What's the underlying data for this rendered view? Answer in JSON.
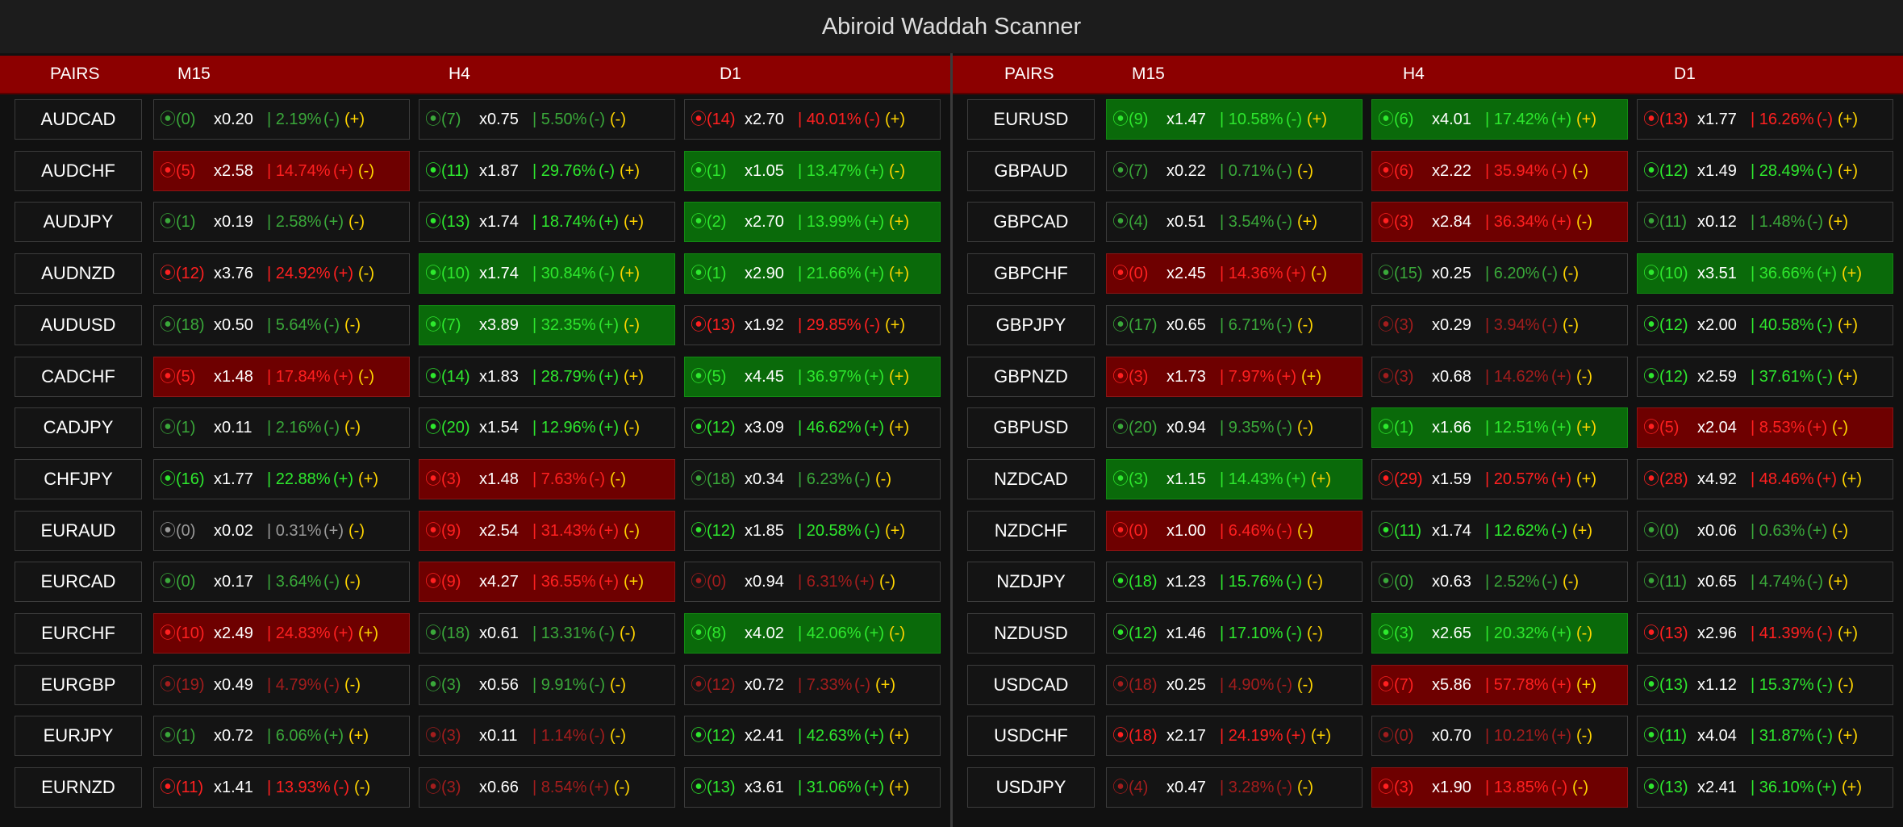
{
  "title": "Abiroid Waddah Scanner",
  "headers": {
    "pairs": "PAIRS",
    "m15": "M15",
    "h4": "H4",
    "d1": "D1"
  },
  "colors": {
    "header_bg": "#8c0000",
    "green": "#2ee82e",
    "red": "#ff2020",
    "yellow": "#ffd400",
    "highlight_green": "#0a6a0a",
    "highlight_red": "#6e0000"
  },
  "icons": {
    "status": "target-icon"
  },
  "left": [
    {
      "pair": "AUDCAD",
      "cells": [
        {
          "status": "⦿(0)",
          "ratio": "x0.20",
          "pct": "| 2.19%",
          "sign": "(-)",
          "arrow": "(+)",
          "color": "dgreen",
          "hl": ""
        },
        {
          "status": "⦿(7)",
          "ratio": "x0.75",
          "pct": "| 5.50%",
          "sign": "(-)",
          "arrow": "(-)",
          "color": "dgreen",
          "hl": ""
        },
        {
          "status": "⦿(14)",
          "ratio": "x2.70",
          "pct": "| 40.01%",
          "sign": "(-)",
          "arrow": "(+)",
          "color": "red",
          "hl": ""
        }
      ]
    },
    {
      "pair": "AUDCHF",
      "cells": [
        {
          "status": "⦿(5)",
          "ratio": "x2.58",
          "pct": "| 14.74%",
          "sign": "(+)",
          "arrow": "(-)",
          "color": "red",
          "hl": "red"
        },
        {
          "status": "⦿(11)",
          "ratio": "x1.87",
          "pct": "| 29.76%",
          "sign": "(-)",
          "arrow": "(+)",
          "color": "green",
          "hl": ""
        },
        {
          "status": "⦿(1)",
          "ratio": "x1.05",
          "pct": "| 13.47%",
          "sign": "(+)",
          "arrow": "(-)",
          "color": "green",
          "hl": "green"
        }
      ]
    },
    {
      "pair": "AUDJPY",
      "cells": [
        {
          "status": "⦿(1)",
          "ratio": "x0.19",
          "pct": "| 2.58%",
          "sign": "(+)",
          "arrow": "(-)",
          "color": "dgreen",
          "hl": ""
        },
        {
          "status": "⦿(13)",
          "ratio": "x1.74",
          "pct": "| 18.74%",
          "sign": "(+)",
          "arrow": "(+)",
          "color": "green",
          "hl": ""
        },
        {
          "status": "⦿(2)",
          "ratio": "x2.70",
          "pct": "| 13.99%",
          "sign": "(+)",
          "arrow": "(+)",
          "color": "green",
          "hl": "green"
        }
      ]
    },
    {
      "pair": "AUDNZD",
      "cells": [
        {
          "status": "⦿(12)",
          "ratio": "x3.76",
          "pct": "| 24.92%",
          "sign": "(+)",
          "arrow": "(-)",
          "color": "red",
          "hl": ""
        },
        {
          "status": "⦿(10)",
          "ratio": "x1.74",
          "pct": "| 30.84%",
          "sign": "(-)",
          "arrow": "(+)",
          "color": "green",
          "hl": "green"
        },
        {
          "status": "⦿(1)",
          "ratio": "x2.90",
          "pct": "| 21.66%",
          "sign": "(+)",
          "arrow": "(+)",
          "color": "green",
          "hl": "green"
        }
      ]
    },
    {
      "pair": "AUDUSD",
      "cells": [
        {
          "status": "⦿(18)",
          "ratio": "x0.50",
          "pct": "| 5.64%",
          "sign": "(-)",
          "arrow": "(-)",
          "color": "dgreen",
          "hl": ""
        },
        {
          "status": "⦿(7)",
          "ratio": "x3.89",
          "pct": "| 32.35%",
          "sign": "(+)",
          "arrow": "(-)",
          "color": "green",
          "hl": "green"
        },
        {
          "status": "⦿(13)",
          "ratio": "x1.92",
          "pct": "| 29.85%",
          "sign": "(-)",
          "arrow": "(+)",
          "color": "red",
          "hl": ""
        }
      ]
    },
    {
      "pair": "CADCHF",
      "cells": [
        {
          "status": "⦿(5)",
          "ratio": "x1.48",
          "pct": "| 17.84%",
          "sign": "(+)",
          "arrow": "(-)",
          "color": "red",
          "hl": "red"
        },
        {
          "status": "⦿(14)",
          "ratio": "x1.83",
          "pct": "| 28.79%",
          "sign": "(+)",
          "arrow": "(+)",
          "color": "green",
          "hl": ""
        },
        {
          "status": "⦿(5)",
          "ratio": "x4.45",
          "pct": "| 36.97%",
          "sign": "(+)",
          "arrow": "(+)",
          "color": "green",
          "hl": "green"
        }
      ]
    },
    {
      "pair": "CADJPY",
      "cells": [
        {
          "status": "⦿(1)",
          "ratio": "x0.11",
          "pct": "| 2.16%",
          "sign": "(-)",
          "arrow": "(-)",
          "color": "dgreen",
          "hl": ""
        },
        {
          "status": "⦿(20)",
          "ratio": "x1.54",
          "pct": "| 12.96%",
          "sign": "(+)",
          "arrow": "(-)",
          "color": "green",
          "hl": ""
        },
        {
          "status": "⦿(12)",
          "ratio": "x3.09",
          "pct": "| 46.62%",
          "sign": "(+)",
          "arrow": "(+)",
          "color": "green",
          "hl": ""
        }
      ]
    },
    {
      "pair": "CHFJPY",
      "cells": [
        {
          "status": "⦿(16)",
          "ratio": "x1.77",
          "pct": "| 22.88%",
          "sign": "(+)",
          "arrow": "(+)",
          "color": "green",
          "hl": ""
        },
        {
          "status": "⦿(3)",
          "ratio": "x1.48",
          "pct": "| 7.63%",
          "sign": "(-)",
          "arrow": "(-)",
          "color": "red",
          "hl": "red"
        },
        {
          "status": "⦿(18)",
          "ratio": "x0.34",
          "pct": "| 6.23%",
          "sign": "(-)",
          "arrow": "(-)",
          "color": "dgreen",
          "hl": ""
        }
      ]
    },
    {
      "pair": "EURAUD",
      "cells": [
        {
          "status": "⦿(0)",
          "ratio": "x0.02",
          "pct": "| 0.31%",
          "sign": "(+)",
          "arrow": "(-)",
          "color": "gray",
          "hl": ""
        },
        {
          "status": "⦿(9)",
          "ratio": "x2.54",
          "pct": "| 31.43%",
          "sign": "(+)",
          "arrow": "(-)",
          "color": "red",
          "hl": "red"
        },
        {
          "status": "⦿(12)",
          "ratio": "x1.85",
          "pct": "| 20.58%",
          "sign": "(-)",
          "arrow": "(+)",
          "color": "green",
          "hl": ""
        }
      ]
    },
    {
      "pair": "EURCAD",
      "cells": [
        {
          "status": "⦿(0)",
          "ratio": "x0.17",
          "pct": "| 3.64%",
          "sign": "(-)",
          "arrow": "(-)",
          "color": "dgreen",
          "hl": ""
        },
        {
          "status": "⦿(9)",
          "ratio": "x4.27",
          "pct": "| 36.55%",
          "sign": "(+)",
          "arrow": "(+)",
          "color": "red",
          "hl": "red"
        },
        {
          "status": "⦿(0)",
          "ratio": "x0.94",
          "pct": "| 6.31%",
          "sign": "(+)",
          "arrow": "(-)",
          "color": "dred",
          "hl": ""
        }
      ]
    },
    {
      "pair": "EURCHF",
      "cells": [
        {
          "status": "⦿(10)",
          "ratio": "x2.49",
          "pct": "| 24.83%",
          "sign": "(+)",
          "arrow": "(+)",
          "color": "red",
          "hl": "red"
        },
        {
          "status": "⦿(18)",
          "ratio": "x0.61",
          "pct": "| 13.31%",
          "sign": "(-)",
          "arrow": "(-)",
          "color": "dgreen",
          "hl": ""
        },
        {
          "status": "⦿(8)",
          "ratio": "x4.02",
          "pct": "| 42.06%",
          "sign": "(+)",
          "arrow": "(-)",
          "color": "green",
          "hl": "green"
        }
      ]
    },
    {
      "pair": "EURGBP",
      "cells": [
        {
          "status": "⦿(19)",
          "ratio": "x0.49",
          "pct": "| 4.79%",
          "sign": "(-)",
          "arrow": "(-)",
          "color": "dred",
          "hl": ""
        },
        {
          "status": "⦿(3)",
          "ratio": "x0.56",
          "pct": "| 9.91%",
          "sign": "(-)",
          "arrow": "(-)",
          "color": "dgreen",
          "hl": ""
        },
        {
          "status": "⦿(12)",
          "ratio": "x0.72",
          "pct": "| 7.33%",
          "sign": "(-)",
          "arrow": "(+)",
          "color": "dred",
          "hl": ""
        }
      ]
    },
    {
      "pair": "EURJPY",
      "cells": [
        {
          "status": "⦿(1)",
          "ratio": "x0.72",
          "pct": "| 6.06%",
          "sign": "(+)",
          "arrow": "(+)",
          "color": "dgreen",
          "hl": ""
        },
        {
          "status": "⦿(3)",
          "ratio": "x0.11",
          "pct": "| 1.14%",
          "sign": "(-)",
          "arrow": "(-)",
          "color": "dred",
          "hl": ""
        },
        {
          "status": "⦿(12)",
          "ratio": "x2.41",
          "pct": "| 42.63%",
          "sign": "(+)",
          "arrow": "(+)",
          "color": "green",
          "hl": ""
        }
      ]
    },
    {
      "pair": "EURNZD",
      "cells": [
        {
          "status": "⦿(11)",
          "ratio": "x1.41",
          "pct": "| 13.93%",
          "sign": "(-)",
          "arrow": "(-)",
          "color": "red",
          "hl": ""
        },
        {
          "status": "⦿(3)",
          "ratio": "x0.66",
          "pct": "| 8.54%",
          "sign": "(+)",
          "arrow": "(-)",
          "color": "dred",
          "hl": ""
        },
        {
          "status": "⦿(13)",
          "ratio": "x3.61",
          "pct": "| 31.06%",
          "sign": "(+)",
          "arrow": "(+)",
          "color": "green",
          "hl": ""
        }
      ]
    }
  ],
  "right": [
    {
      "pair": "EURUSD",
      "cells": [
        {
          "status": "⦿(9)",
          "ratio": "x1.47",
          "pct": "| 10.58%",
          "sign": "(-)",
          "arrow": "(+)",
          "color": "green",
          "hl": "green"
        },
        {
          "status": "⦿(6)",
          "ratio": "x4.01",
          "pct": "| 17.42%",
          "sign": "(+)",
          "arrow": "(+)",
          "color": "green",
          "hl": "green"
        },
        {
          "status": "⦿(13)",
          "ratio": "x1.77",
          "pct": "| 16.26%",
          "sign": "(-)",
          "arrow": "(+)",
          "color": "red",
          "hl": ""
        }
      ]
    },
    {
      "pair": "GBPAUD",
      "cells": [
        {
          "status": "⦿(7)",
          "ratio": "x0.22",
          "pct": "| 0.71%",
          "sign": "(-)",
          "arrow": "(-)",
          "color": "dgreen",
          "hl": ""
        },
        {
          "status": "⦿(6)",
          "ratio": "x2.22",
          "pct": "| 35.94%",
          "sign": "(-)",
          "arrow": "(-)",
          "color": "red",
          "hl": "red"
        },
        {
          "status": "⦿(12)",
          "ratio": "x1.49",
          "pct": "| 28.49%",
          "sign": "(-)",
          "arrow": "(+)",
          "color": "green",
          "hl": ""
        }
      ]
    },
    {
      "pair": "GBPCAD",
      "cells": [
        {
          "status": "⦿(4)",
          "ratio": "x0.51",
          "pct": "| 3.54%",
          "sign": "(-)",
          "arrow": "(+)",
          "color": "dgreen",
          "hl": ""
        },
        {
          "status": "⦿(3)",
          "ratio": "x2.84",
          "pct": "| 36.34%",
          "sign": "(+)",
          "arrow": "(-)",
          "color": "red",
          "hl": "red"
        },
        {
          "status": "⦿(11)",
          "ratio": "x0.12",
          "pct": "| 1.48%",
          "sign": "(-)",
          "arrow": "(+)",
          "color": "dgreen",
          "hl": ""
        }
      ]
    },
    {
      "pair": "GBPCHF",
      "cells": [
        {
          "status": "⦿(0)",
          "ratio": "x2.45",
          "pct": "| 14.36%",
          "sign": "(+)",
          "arrow": "(-)",
          "color": "red",
          "hl": "red"
        },
        {
          "status": "⦿(15)",
          "ratio": "x0.25",
          "pct": "| 6.20%",
          "sign": "(-)",
          "arrow": "(-)",
          "color": "dgreen",
          "hl": ""
        },
        {
          "status": "⦿(10)",
          "ratio": "x3.51",
          "pct": "| 36.66%",
          "sign": "(+)",
          "arrow": "(+)",
          "color": "green",
          "hl": "green"
        }
      ]
    },
    {
      "pair": "GBPJPY",
      "cells": [
        {
          "status": "⦿(17)",
          "ratio": "x0.65",
          "pct": "| 6.71%",
          "sign": "(-)",
          "arrow": "(-)",
          "color": "dgreen",
          "hl": ""
        },
        {
          "status": "⦿(3)",
          "ratio": "x0.29",
          "pct": "| 3.94%",
          "sign": "(-)",
          "arrow": "(-)",
          "color": "dred",
          "hl": ""
        },
        {
          "status": "⦿(12)",
          "ratio": "x2.00",
          "pct": "| 40.58%",
          "sign": "(-)",
          "arrow": "(+)",
          "color": "green",
          "hl": ""
        }
      ]
    },
    {
      "pair": "GBPNZD",
      "cells": [
        {
          "status": "⦿(3)",
          "ratio": "x1.73",
          "pct": "| 7.97%",
          "sign": "(+)",
          "arrow": "(+)",
          "color": "red",
          "hl": "red"
        },
        {
          "status": "⦿(3)",
          "ratio": "x0.68",
          "pct": "| 14.62%",
          "sign": "(+)",
          "arrow": "(-)",
          "color": "dred",
          "hl": ""
        },
        {
          "status": "⦿(12)",
          "ratio": "x2.59",
          "pct": "| 37.61%",
          "sign": "(-)",
          "arrow": "(+)",
          "color": "green",
          "hl": ""
        }
      ]
    },
    {
      "pair": "GBPUSD",
      "cells": [
        {
          "status": "⦿(20)",
          "ratio": "x0.94",
          "pct": "| 9.35%",
          "sign": "(-)",
          "arrow": "(-)",
          "color": "dgreen",
          "hl": ""
        },
        {
          "status": "⦿(1)",
          "ratio": "x1.66",
          "pct": "| 12.51%",
          "sign": "(+)",
          "arrow": "(+)",
          "color": "green",
          "hl": "green"
        },
        {
          "status": "⦿(5)",
          "ratio": "x2.04",
          "pct": "| 8.53%",
          "sign": "(+)",
          "arrow": "(-)",
          "color": "red",
          "hl": "red"
        }
      ]
    },
    {
      "pair": "NZDCAD",
      "cells": [
        {
          "status": "⦿(3)",
          "ratio": "x1.15",
          "pct": "| 14.43%",
          "sign": "(+)",
          "arrow": "(+)",
          "color": "green",
          "hl": "green"
        },
        {
          "status": "⦿(29)",
          "ratio": "x1.59",
          "pct": "| 20.57%",
          "sign": "(+)",
          "arrow": "(+)",
          "color": "red",
          "hl": ""
        },
        {
          "status": "⦿(28)",
          "ratio": "x4.92",
          "pct": "| 48.46%",
          "sign": "(+)",
          "arrow": "(+)",
          "color": "red",
          "hl": ""
        }
      ]
    },
    {
      "pair": "NZDCHF",
      "cells": [
        {
          "status": "⦿(0)",
          "ratio": "x1.00",
          "pct": "| 6.46%",
          "sign": "(-)",
          "arrow": "(-)",
          "color": "red",
          "hl": "red"
        },
        {
          "status": "⦿(11)",
          "ratio": "x1.74",
          "pct": "| 12.62%",
          "sign": "(-)",
          "arrow": "(+)",
          "color": "green",
          "hl": ""
        },
        {
          "status": "⦿(0)",
          "ratio": "x0.06",
          "pct": "| 0.63%",
          "sign": "(+)",
          "arrow": "(-)",
          "color": "dgreen",
          "hl": ""
        }
      ]
    },
    {
      "pair": "NZDJPY",
      "cells": [
        {
          "status": "⦿(18)",
          "ratio": "x1.23",
          "pct": "| 15.76%",
          "sign": "(-)",
          "arrow": "(-)",
          "color": "green",
          "hl": ""
        },
        {
          "status": "⦿(0)",
          "ratio": "x0.63",
          "pct": "| 2.52%",
          "sign": "(-)",
          "arrow": "(-)",
          "color": "dgreen",
          "hl": ""
        },
        {
          "status": "⦿(11)",
          "ratio": "x0.65",
          "pct": "| 4.74%",
          "sign": "(-)",
          "arrow": "(+)",
          "color": "dgreen",
          "hl": ""
        }
      ]
    },
    {
      "pair": "NZDUSD",
      "cells": [
        {
          "status": "⦿(12)",
          "ratio": "x1.46",
          "pct": "| 17.10%",
          "sign": "(-)",
          "arrow": "(-)",
          "color": "green",
          "hl": ""
        },
        {
          "status": "⦿(3)",
          "ratio": "x2.65",
          "pct": "| 20.32%",
          "sign": "(+)",
          "arrow": "(-)",
          "color": "green",
          "hl": "green"
        },
        {
          "status": "⦿(13)",
          "ratio": "x2.96",
          "pct": "| 41.39%",
          "sign": "(-)",
          "arrow": "(+)",
          "color": "red",
          "hl": ""
        }
      ]
    },
    {
      "pair": "USDCAD",
      "cells": [
        {
          "status": "⦿(18)",
          "ratio": "x0.25",
          "pct": "| 4.90%",
          "sign": "(-)",
          "arrow": "(-)",
          "color": "dred",
          "hl": ""
        },
        {
          "status": "⦿(7)",
          "ratio": "x5.86",
          "pct": "| 57.78%",
          "sign": "(+)",
          "arrow": "(+)",
          "color": "red",
          "hl": "red"
        },
        {
          "status": "⦿(13)",
          "ratio": "x1.12",
          "pct": "| 15.37%",
          "sign": "(-)",
          "arrow": "(-)",
          "color": "green",
          "hl": ""
        }
      ]
    },
    {
      "pair": "USDCHF",
      "cells": [
        {
          "status": "⦿(18)",
          "ratio": "x2.17",
          "pct": "| 24.19%",
          "sign": "(+)",
          "arrow": "(+)",
          "color": "red",
          "hl": ""
        },
        {
          "status": "⦿(0)",
          "ratio": "x0.70",
          "pct": "| 10.21%",
          "sign": "(+)",
          "arrow": "(-)",
          "color": "dred",
          "hl": ""
        },
        {
          "status": "⦿(11)",
          "ratio": "x4.04",
          "pct": "| 31.87%",
          "sign": "(-)",
          "arrow": "(+)",
          "color": "green",
          "hl": ""
        }
      ]
    },
    {
      "pair": "USDJPY",
      "cells": [
        {
          "status": "⦿(4)",
          "ratio": "x0.47",
          "pct": "| 3.28%",
          "sign": "(-)",
          "arrow": "(-)",
          "color": "dred",
          "hl": ""
        },
        {
          "status": "⦿(3)",
          "ratio": "x1.90",
          "pct": "| 13.85%",
          "sign": "(-)",
          "arrow": "(-)",
          "color": "red",
          "hl": "red"
        },
        {
          "status": "⦿(13)",
          "ratio": "x2.41",
          "pct": "| 36.10%",
          "sign": "(+)",
          "arrow": "(+)",
          "color": "green",
          "hl": ""
        }
      ]
    }
  ]
}
